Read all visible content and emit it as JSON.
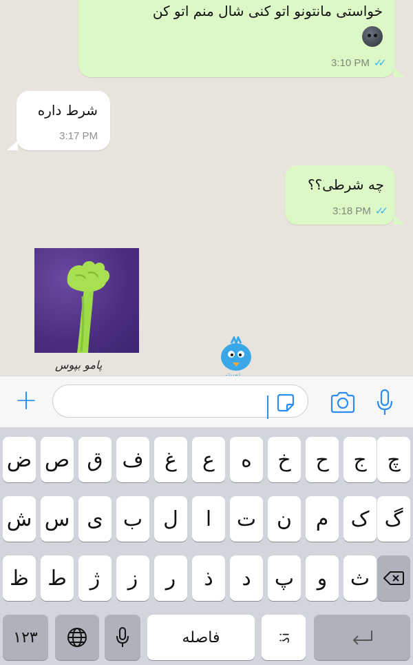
{
  "messages": [
    {
      "direction": "outgoing",
      "text": "خواستی مانتونو اتو کنی شال منم اتو کن",
      "time": "3:10 PM",
      "status": "read"
    },
    {
      "direction": "incoming",
      "text": "شرط داره",
      "time": "3:17 PM"
    },
    {
      "direction": "outgoing",
      "text": "چه شرطی؟؟",
      "time": "3:18 PM",
      "status": "read"
    },
    {
      "direction": "incoming",
      "type": "sticker",
      "caption": "پامو بپوس"
    }
  ],
  "watermark": {
    "text": "توییتی"
  },
  "input_bar": {
    "placeholder": ""
  },
  "keyboard": {
    "row1": [
      "ض",
      "ص",
      "ق",
      "ف",
      "غ",
      "ع",
      "ه",
      "خ",
      "ح",
      "ج",
      "چ"
    ],
    "row2": [
      "ش",
      "س",
      "ی",
      "ب",
      "ل",
      "ا",
      "ت",
      "ن",
      "م",
      "ک",
      "گ"
    ],
    "row3": [
      "ظ",
      "ط",
      "ژ",
      "ز",
      "ر",
      "ذ",
      "د",
      "پ",
      "و",
      "ث"
    ],
    "numbers_label": "۱۲۳",
    "space_label": "فاصله",
    "punct_label": "؟!"
  },
  "colors": {
    "outgoing_bubble": "#dcf8c6",
    "incoming_bubble": "#ffffff",
    "accent": "#2a8cf0",
    "read_ticks": "#34b7f1"
  }
}
